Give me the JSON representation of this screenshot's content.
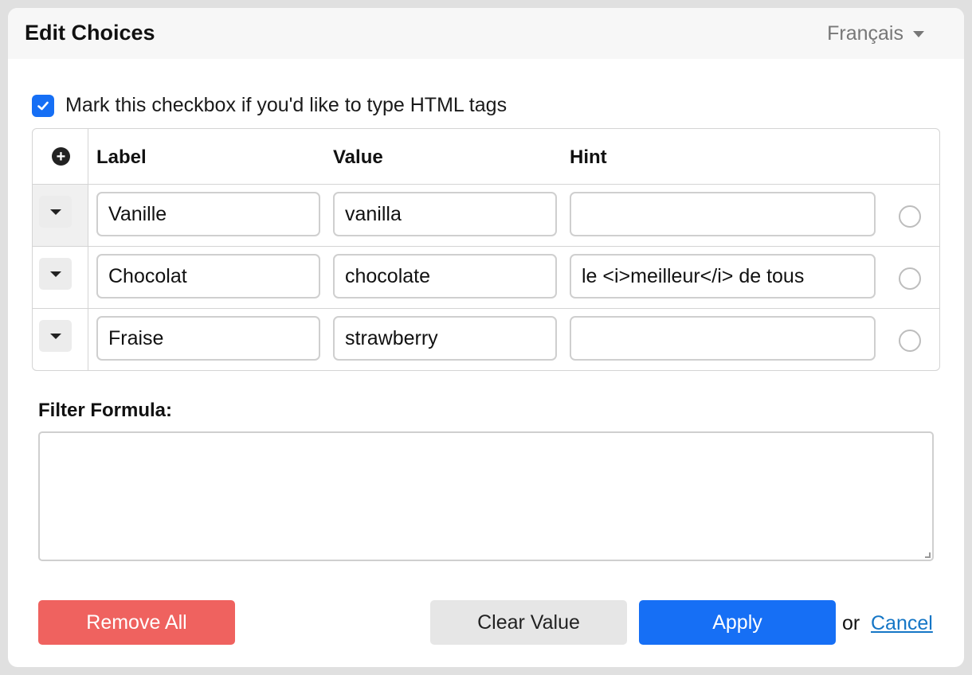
{
  "header": {
    "title": "Edit Choices",
    "language": "Français"
  },
  "html_toggle": {
    "checked": true,
    "label": "Mark this checkbox if you'd like to type HTML tags"
  },
  "table": {
    "columns": [
      "Label",
      "Value",
      "Hint"
    ],
    "rows": [
      {
        "label": "Vanille",
        "value": "vanilla",
        "hint": ""
      },
      {
        "label": "Chocolat",
        "value": "chocolate",
        "hint": "le <i>meilleur</i> de tous"
      },
      {
        "label": "Fraise",
        "value": "strawberry",
        "hint": ""
      }
    ]
  },
  "filter": {
    "label": "Filter Formula:",
    "value": ""
  },
  "footer": {
    "remove_all": "Remove All",
    "clear_value": "Clear Value",
    "apply": "Apply",
    "or": "or",
    "cancel": "Cancel"
  },
  "colors": {
    "accent": "#166ff5",
    "danger": "#ef625f",
    "link": "#1576c6"
  }
}
